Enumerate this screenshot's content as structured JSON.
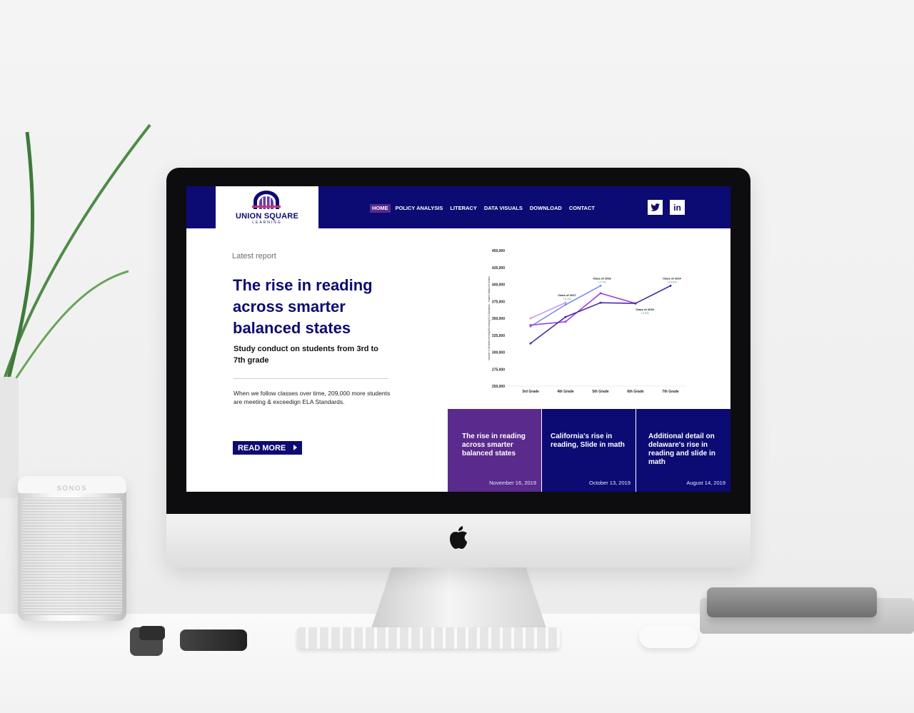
{
  "speaker": {
    "brand": "SONOS"
  },
  "site": {
    "logo": {
      "title": "UNION SQUARE",
      "subtitle": "LEARNING"
    },
    "nav": [
      {
        "label": "HOME",
        "active": true
      },
      {
        "label": "POLICY ANALYSIS",
        "active": false
      },
      {
        "label": "LITERACY",
        "active": false
      },
      {
        "label": "DATA VISUALS",
        "active": false
      },
      {
        "label": "DOWNLOAD",
        "active": false
      },
      {
        "label": "CONTACT",
        "active": false
      }
    ],
    "social": [
      {
        "icon": "twitter-icon",
        "glyph": "🐦"
      },
      {
        "icon": "linkedin-icon",
        "glyph": "in"
      }
    ],
    "colors": {
      "navy": "#0c0b73",
      "purple": "#5a2a8c",
      "accent_green": "#2e9d5a"
    }
  },
  "hero": {
    "eyebrow": "Latest report",
    "headline": "The rise in reading across smarter balanced states",
    "subhead": "Study conduct on students from 3rd to 7th grade",
    "body": "When we follow classes over time, 209,000 more students are meeting & exceedign ELA Standards.",
    "cta": "READ MORE"
  },
  "chart_data": {
    "type": "line",
    "ylabel": "Number of Students Meeting/Exceeding ELA Standards - Smarter Balanced Exams",
    "ylim": [
      250000,
      450000
    ],
    "yticks": [
      "450,000",
      "425,000",
      "400,000",
      "375,000",
      "350,000",
      "325,000",
      "300,000",
      "275,000",
      "250,000"
    ],
    "categories": [
      "3rd Grade",
      "4th Grade",
      "5th Grade",
      "6th Grade",
      "7th Grade"
    ],
    "series": [
      {
        "name": "Class of 2027",
        "values": [
          350000,
          373000,
          null,
          null,
          null
        ],
        "color": "#c79bf0",
        "label_at": 1,
        "change": "+4.1%"
      },
      {
        "name": "Class of 2026",
        "values": [
          338000,
          370000,
          398000,
          null,
          null
        ],
        "color": "#7f8ff0",
        "label_at": 2,
        "change": "+7.7%"
      },
      {
        "name": "Class of 2025",
        "values": [
          340000,
          345000,
          387000,
          372000,
          null
        ],
        "color": "#9a3fe0",
        "label_at": 3,
        "change": "+4.0%"
      },
      {
        "name": "Class of 2024",
        "values": [
          313000,
          352000,
          373000,
          372000,
          398000
        ],
        "color": "#4b2aa6",
        "label_at": 4,
        "change": "+10.5%"
      }
    ],
    "grid": false,
    "legend": "inline"
  },
  "cards": [
    {
      "title": "The rise in reading across smarter balanced states",
      "date": "November 16, 2019",
      "bg": "#5a2a8c"
    },
    {
      "title": "California's rise in reading, Slide in math",
      "date": "October 13, 2019",
      "bg": "#0c0b73"
    },
    {
      "title": "Additional detail on delaware's rise in reading and slide in math",
      "date": "August 14, 2019",
      "bg": "#0c0b73"
    }
  ]
}
